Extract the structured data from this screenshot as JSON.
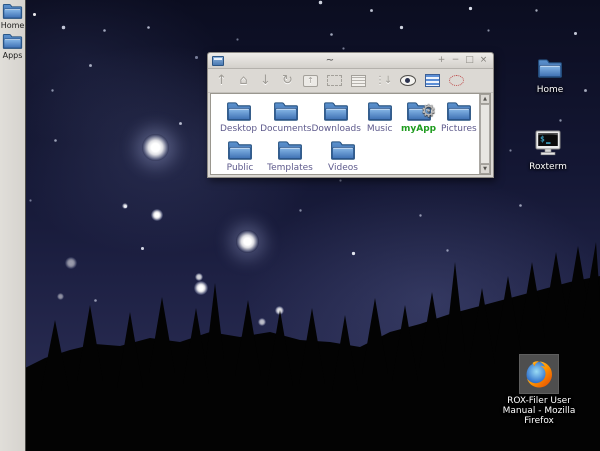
{
  "panel": {
    "items": [
      {
        "label": "Home"
      },
      {
        "label": "Apps"
      }
    ]
  },
  "window": {
    "title": "~",
    "buttons": [
      {
        "name": "shade",
        "glyph": "+"
      },
      {
        "name": "minimize",
        "glyph": "−"
      },
      {
        "name": "maximize",
        "glyph": "□"
      },
      {
        "name": "close",
        "glyph": "×"
      }
    ],
    "toolbar": [
      {
        "name": "up",
        "glyph": "↑"
      },
      {
        "name": "home",
        "glyph": "⌂"
      },
      {
        "name": "bookmarks",
        "glyph": "↓"
      },
      {
        "name": "refresh",
        "glyph": "↻"
      },
      {
        "name": "scan",
        "glyph": "↑"
      },
      {
        "name": "resize-window",
        "glyph": ""
      },
      {
        "name": "details-view",
        "glyph": ""
      },
      {
        "name": "sort",
        "glyph": "⋮↓"
      },
      {
        "name": "show-hidden",
        "glyph": ""
      },
      {
        "name": "select-all",
        "glyph": ""
      },
      {
        "name": "help",
        "glyph": ""
      }
    ],
    "files": [
      {
        "name": "Desktop"
      },
      {
        "name": "Documents"
      },
      {
        "name": "Downloads"
      },
      {
        "name": "Music"
      },
      {
        "name": "myApp"
      },
      {
        "name": "Pictures"
      },
      {
        "name": "Public"
      },
      {
        "name": "Templates"
      },
      {
        "name": "Videos"
      }
    ],
    "scrollbar": {
      "up": "▲",
      "down": "▼"
    }
  },
  "desktop_icons": {
    "home": {
      "label": "Home"
    },
    "roxterm": {
      "label": "Roxterm"
    },
    "firefox": {
      "label": "ROX-Filer User Manual - Mozilla Firefox"
    }
  },
  "colors": {
    "folder_blue": "#4a79b2",
    "label_purple": "#5e5a8c",
    "myapp_green": "#1f9c1f",
    "sky_top": "#0b0d20",
    "panel_gray": "#d6d3ce",
    "tree_black": "#030303"
  }
}
